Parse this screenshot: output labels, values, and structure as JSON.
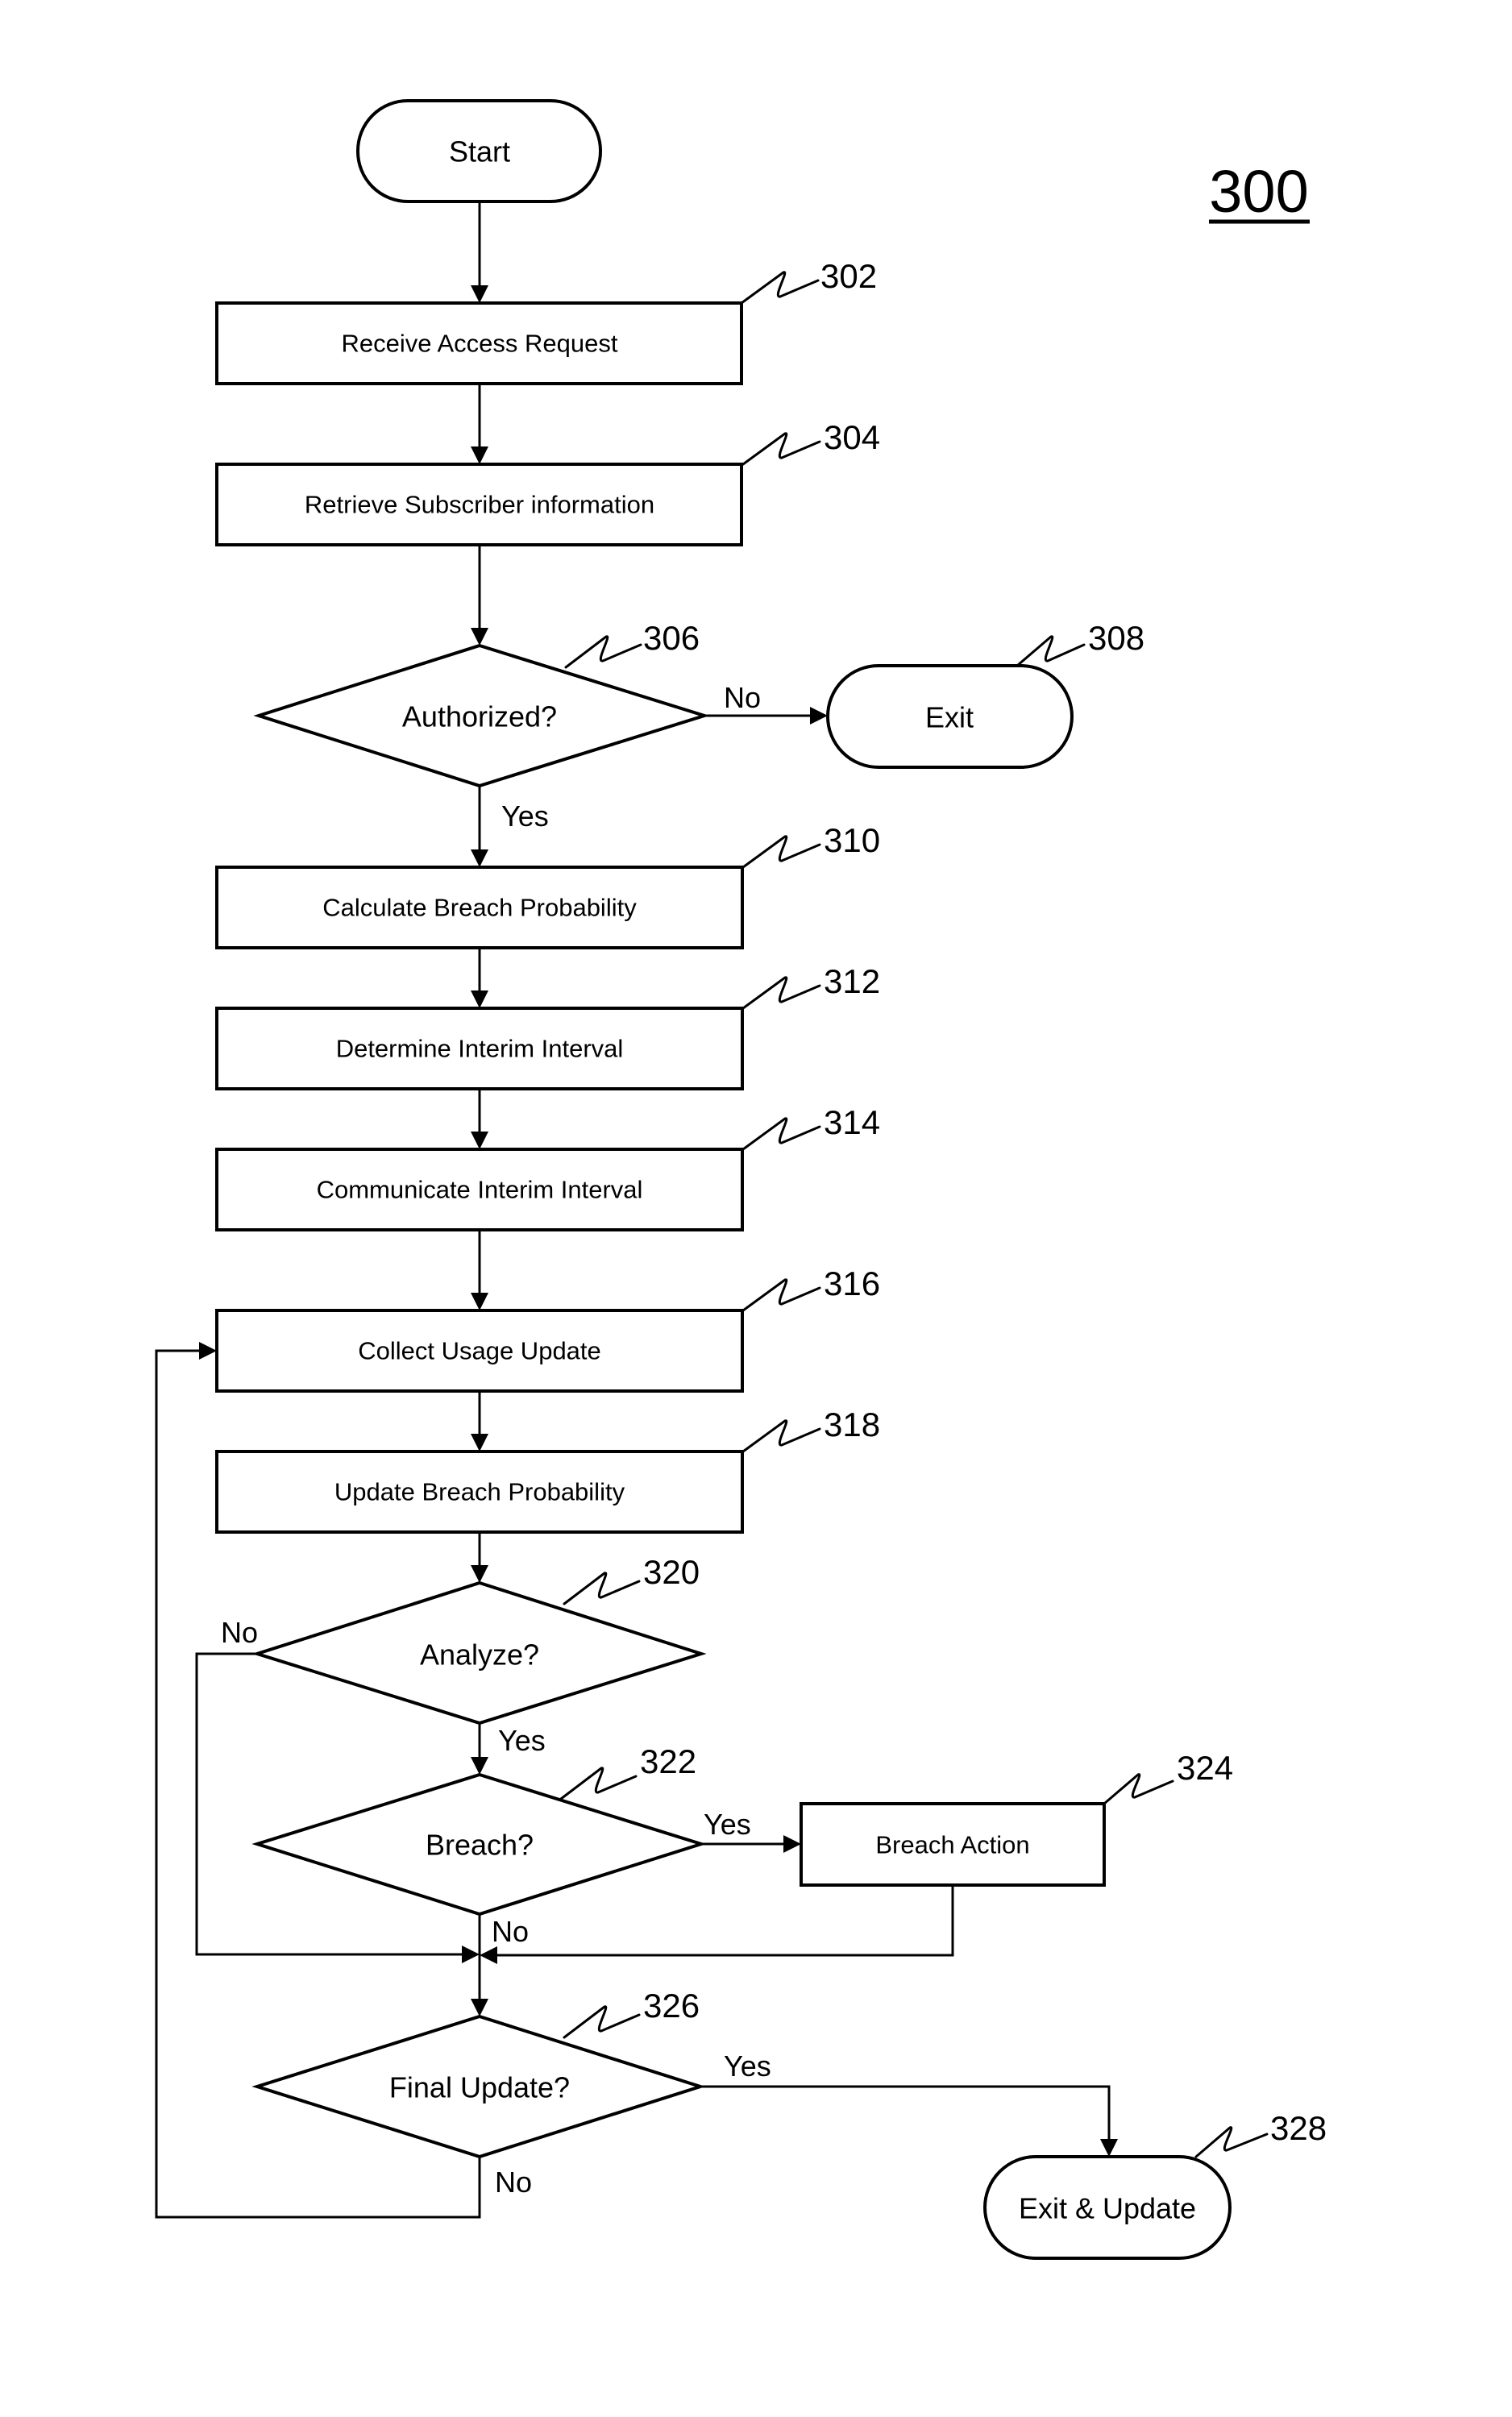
{
  "figure": {
    "number": "300"
  },
  "nodes": {
    "start": {
      "label": "Start",
      "type": "terminal"
    },
    "n302": {
      "ref": "302",
      "label": "Receive Access Request",
      "type": "process"
    },
    "n304": {
      "ref": "304",
      "label": "Retrieve Subscriber information",
      "type": "process"
    },
    "n306": {
      "ref": "306",
      "label": "Authorized?",
      "type": "decision"
    },
    "n308": {
      "ref": "308",
      "label": "Exit",
      "type": "terminal"
    },
    "n310": {
      "ref": "310",
      "label": "Calculate Breach Probability",
      "type": "process"
    },
    "n312": {
      "ref": "312",
      "label": "Determine Interim Interval",
      "type": "process"
    },
    "n314": {
      "ref": "314",
      "label": "Communicate Interim Interval",
      "type": "process"
    },
    "n316": {
      "ref": "316",
      "label": "Collect Usage Update",
      "type": "process"
    },
    "n318": {
      "ref": "318",
      "label": "Update Breach Probability",
      "type": "process"
    },
    "n320": {
      "ref": "320",
      "label": "Analyze?",
      "type": "decision"
    },
    "n322": {
      "ref": "322",
      "label": "Breach?",
      "type": "decision"
    },
    "n324": {
      "ref": "324",
      "label": "Breach Action",
      "type": "process"
    },
    "n326": {
      "ref": "326",
      "label": "Final Update?",
      "type": "decision"
    },
    "n328": {
      "ref": "328",
      "label": "Exit & Update",
      "type": "terminal"
    }
  },
  "edges": {
    "e306_no": {
      "from": "306",
      "to": "308",
      "label": "No"
    },
    "e306_yes": {
      "from": "306",
      "to": "310",
      "label": "Yes"
    },
    "e320_no": {
      "from": "320",
      "to": "326",
      "label": "No"
    },
    "e320_yes": {
      "from": "320",
      "to": "322",
      "label": "Yes"
    },
    "e322_yes": {
      "from": "322",
      "to": "324",
      "label": "Yes"
    },
    "e322_no": {
      "from": "322",
      "to": "326",
      "label": "No"
    },
    "e326_yes": {
      "from": "326",
      "to": "328",
      "label": "Yes"
    },
    "e326_no": {
      "from": "326",
      "to": "316",
      "label": "No"
    }
  }
}
